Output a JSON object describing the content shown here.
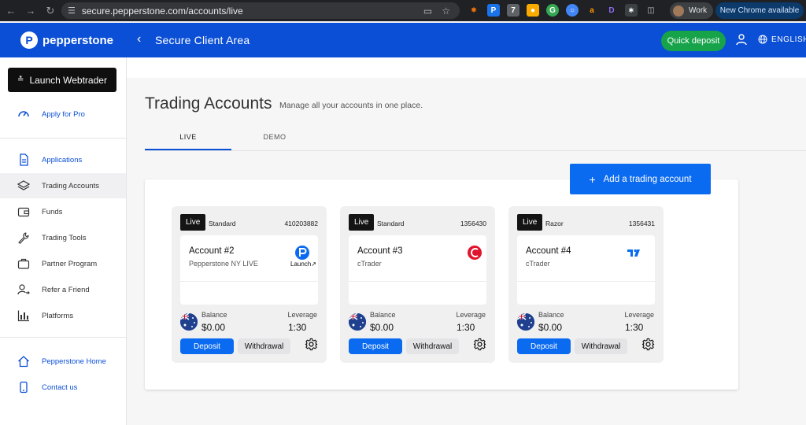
{
  "browser": {
    "url": "secure.pepperstone.com/accounts/live",
    "profile": "Work",
    "update_label": "New Chrome available"
  },
  "header": {
    "brand": "pepperstone",
    "title": "Secure Client Area",
    "quick_deposit": "Quick deposit",
    "language": "ENGLISH"
  },
  "sidebar": {
    "launch": "Launch Webtrader",
    "apply_pro": "Apply for Pro",
    "items": [
      {
        "label": "Applications",
        "icon": "document-icon",
        "style": "blue"
      },
      {
        "label": "Trading Accounts",
        "icon": "layers-icon",
        "style": "active"
      },
      {
        "label": "Funds",
        "icon": "wallet-icon",
        "style": ""
      },
      {
        "label": "Trading Tools",
        "icon": "wrench-icon",
        "style": ""
      },
      {
        "label": "Partner Program",
        "icon": "briefcase-icon",
        "style": ""
      },
      {
        "label": "Refer a Friend",
        "icon": "refer-icon",
        "style": ""
      },
      {
        "label": "Platforms",
        "icon": "bar-chart-icon",
        "style": ""
      }
    ],
    "home": "Pepperstone Home",
    "contact": "Contact us"
  },
  "main": {
    "title": "Trading Accounts",
    "subtitle": "Manage all your accounts in one place.",
    "tabs": [
      "LIVE",
      "DEMO"
    ],
    "add_account": "Add a trading account"
  },
  "cards": [
    {
      "badge": "Live",
      "type": "Standard",
      "number": "410203882",
      "name": "Account #2",
      "platform": "Pepperstone NY LIVE",
      "platform_icon": "pepperstone-icon",
      "launch": "Launch",
      "balance_label": "Balance",
      "balance": "$0.00",
      "leverage_label": "Leverage",
      "leverage": "1:30",
      "deposit": "Deposit",
      "withdrawal": "Withdrawal"
    },
    {
      "badge": "Live",
      "type": "Standard",
      "number": "1356430",
      "name": "Account #3",
      "platform": "cTrader",
      "platform_icon": "ctrader-icon",
      "launch": "",
      "balance_label": "Balance",
      "balance": "$0.00",
      "leverage_label": "Leverage",
      "leverage": "1:30",
      "deposit": "Deposit",
      "withdrawal": "Withdrawal"
    },
    {
      "badge": "Live",
      "type": "Razor",
      "number": "1356431",
      "name": "Account #4",
      "platform": "cTrader",
      "platform_icon": "tradingview-icon",
      "launch": "",
      "balance_label": "Balance",
      "balance": "$0.00",
      "leverage_label": "Leverage",
      "leverage": "1:30",
      "deposit": "Deposit",
      "withdrawal": "Withdrawal"
    }
  ],
  "colors": {
    "brand_blue": "#0b4fd6",
    "action_blue": "#0b6bf0",
    "quick_deposit_green": "#16a34a"
  }
}
